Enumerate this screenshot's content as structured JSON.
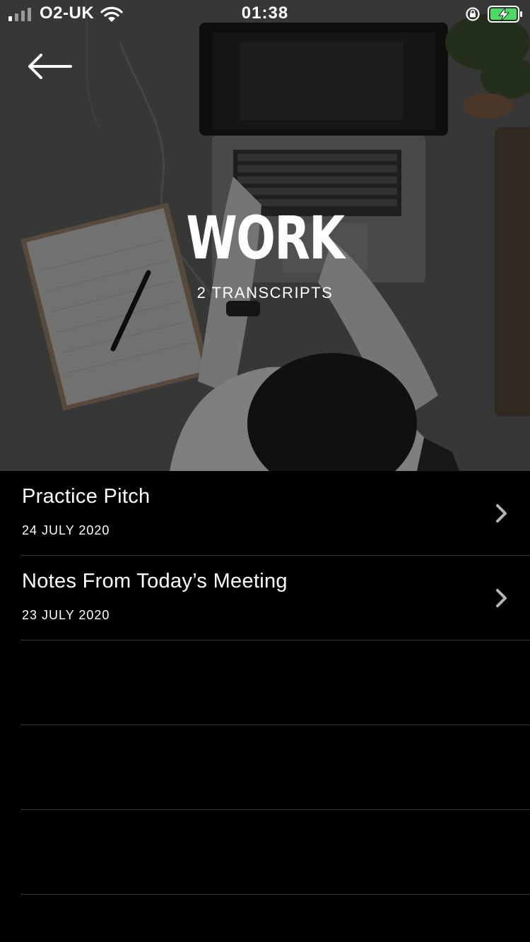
{
  "status_bar": {
    "carrier": "O2-UK",
    "time": "01:38"
  },
  "header": {
    "back_icon": "arrow-left-icon",
    "title": "WORK",
    "subtitle": "2 TRANSCRIPTS"
  },
  "transcripts": [
    {
      "name": "Practice Pitch",
      "date": "24 JULY 2020"
    },
    {
      "name": "Notes From Today’s Meeting",
      "date": "23 JULY 2020"
    }
  ],
  "colors": {
    "background": "#000000",
    "text": "#ffffff",
    "divider": "#3a3a3a",
    "chevron": "#b5b5b5",
    "battery_fill": "#4cd964"
  }
}
